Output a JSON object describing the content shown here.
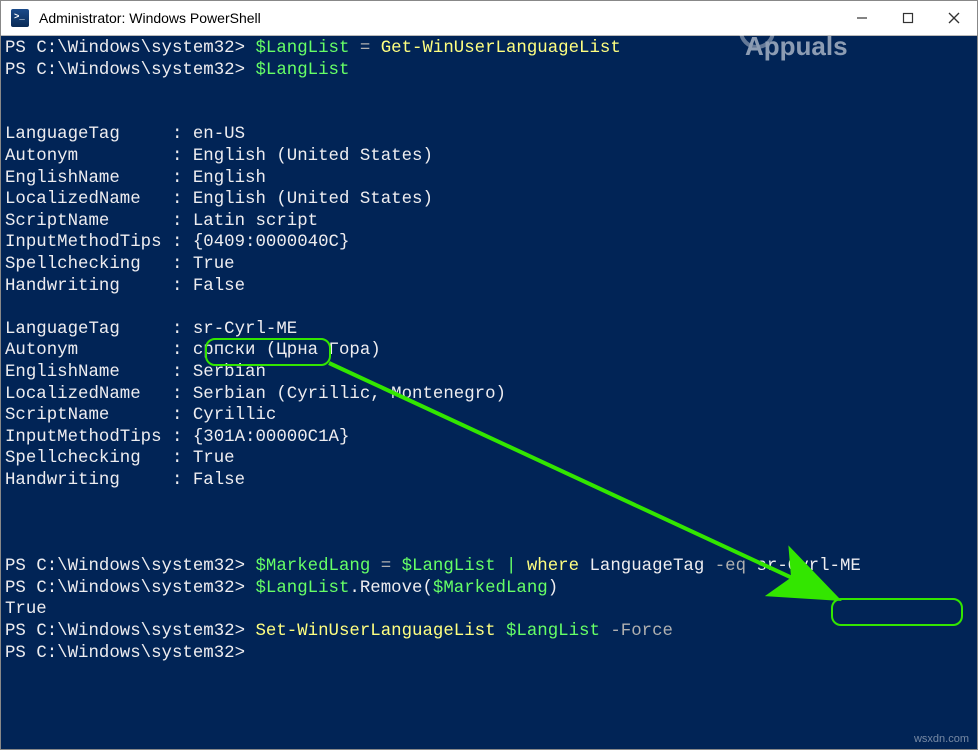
{
  "window": {
    "title": "Administrator: Windows PowerShell"
  },
  "prompt": {
    "ps": "PS",
    "path": "C:\\Windows\\system32>"
  },
  "cmd": {
    "var_langlist": "$LangList",
    "var_markedlang": "$MarkedLang",
    "eq": " = ",
    "get_lang": "Get-WinUserLanguageList",
    "set_lang": "Set-WinUserLanguageList",
    "pipe": " | ",
    "where": "where",
    "langtag_word": "LanguageTag",
    "dash_eq": "-eq",
    "dash_force": "-Force",
    "tag_value": "sr-Cyrl-ME",
    "remove_open": ".Remove(",
    "remove_close": ")",
    "true_out": "True"
  },
  "fields": {
    "LanguageTag": "LanguageTag",
    "Autonym": "Autonym",
    "EnglishName": "EnglishName",
    "LocalizedName": "LocalizedName",
    "ScriptName": "ScriptName",
    "InputMethodTips": "InputMethodTips",
    "Spellchecking": "Spellchecking",
    "Handwriting": "Handwriting",
    "colon": ":"
  },
  "lang1": {
    "LanguageTag": "en-US",
    "Autonym": "English (United States)",
    "EnglishName": "English",
    "LocalizedName": "English (United States)",
    "ScriptName": "Latin script",
    "InputMethodTips": "{0409:0000040C}",
    "Spellchecking": "True",
    "Handwriting": "False"
  },
  "lang2": {
    "LanguageTag": "sr-Cyrl-ME",
    "Autonym": "српски (Црна Гора)",
    "EnglishName": "Serbian",
    "LocalizedName": "Serbian (Cyrillic, Montenegro)",
    "ScriptName": "Cyrillic",
    "InputMethodTips": "{301A:00000C1A}",
    "Spellchecking": "True",
    "Handwriting": "False"
  },
  "watermark": {
    "text": "Appuals"
  },
  "footer": {
    "text": "wsxdn.com"
  }
}
